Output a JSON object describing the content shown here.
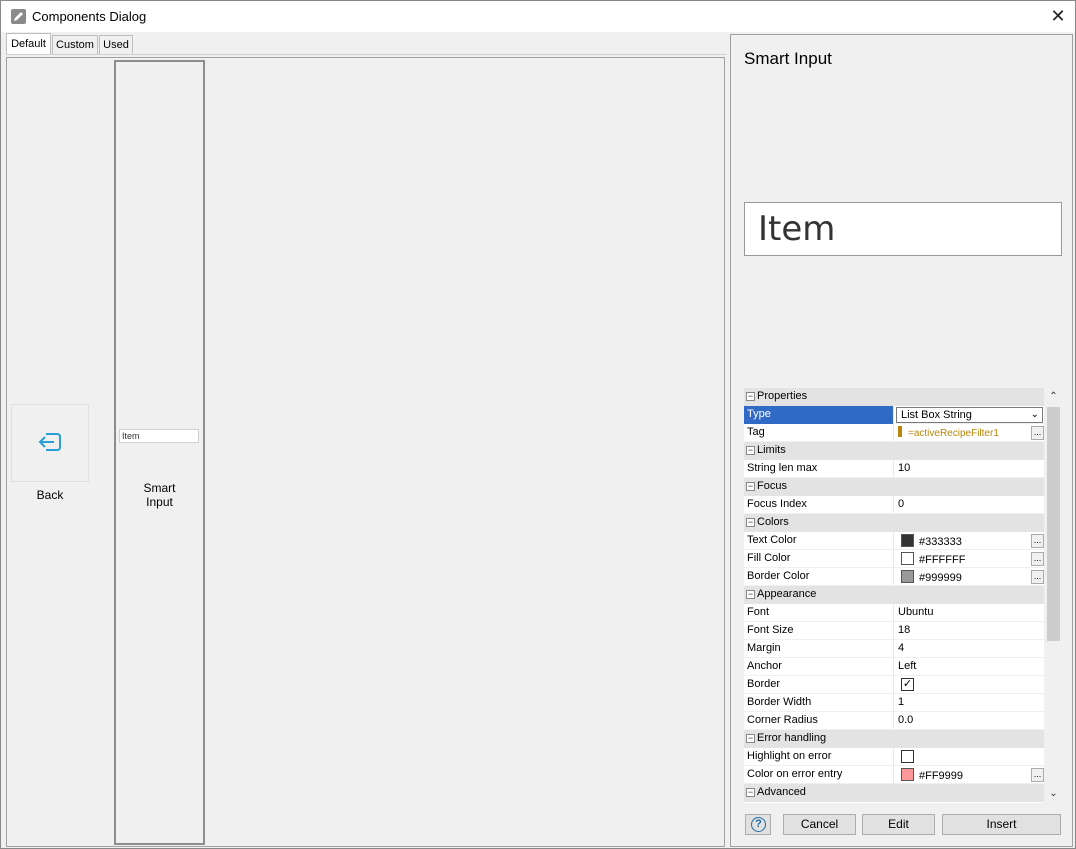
{
  "window": {
    "title": "Components Dialog",
    "close_glyph": "✕"
  },
  "tabs": [
    {
      "label": "Default",
      "active": true
    },
    {
      "label": "Custom",
      "active": false
    },
    {
      "label": "Used",
      "active": false
    }
  ],
  "gallery": {
    "back": {
      "label": "Back",
      "icon": "back-arrow-icon"
    },
    "smart_input": {
      "preview_text": "Item",
      "label_line1": "Smart",
      "label_line2": "Input"
    }
  },
  "preview": {
    "title": "Smart Input",
    "sample_text": "Item"
  },
  "properties": {
    "cat_properties": "Properties",
    "type_name": "Type",
    "type_value": "List Box String",
    "tag_name": "Tag",
    "tag_value": "=activeRecipeFilter1",
    "cat_limits": "Limits",
    "strlen_name": "String len max",
    "strlen_value": "10",
    "cat_focus": "Focus",
    "focus_name": "Focus Index",
    "focus_value": "0",
    "cat_colors": "Colors",
    "textcolor_name": "Text Color",
    "textcolor_value": "#333333",
    "fillcolor_name": "Fill Color",
    "fillcolor_value": "#FFFFFF",
    "bordercolor_name": "Border Color",
    "bordercolor_value": "#999999",
    "cat_appearance": "Appearance",
    "font_name": "Font",
    "font_value": "Ubuntu",
    "fontsize_name": "Font Size",
    "fontsize_value": "18",
    "margin_name": "Margin",
    "margin_value": "4",
    "anchor_name": "Anchor",
    "anchor_value": "Left",
    "border_name": "Border",
    "border_checked": true,
    "borderwidth_name": "Border Width",
    "borderwidth_value": "1",
    "corner_name": "Corner Radius",
    "corner_value": "0.0",
    "cat_error": "Error handling",
    "highlight_name": "Highlight on error",
    "highlight_checked": false,
    "errcolor_name": "Color on error entry",
    "errcolor_value": "#FF9999",
    "cat_advanced": "Advanced",
    "ellipsis": "...",
    "collapse_glyph": "−"
  },
  "buttons": {
    "help": "?",
    "cancel": "Cancel",
    "edit": "Edit",
    "insert": "Insert"
  },
  "colors": {
    "selection": "#3169c6",
    "tag": "#b8860b",
    "icon_blue": "#2a9fd6"
  }
}
